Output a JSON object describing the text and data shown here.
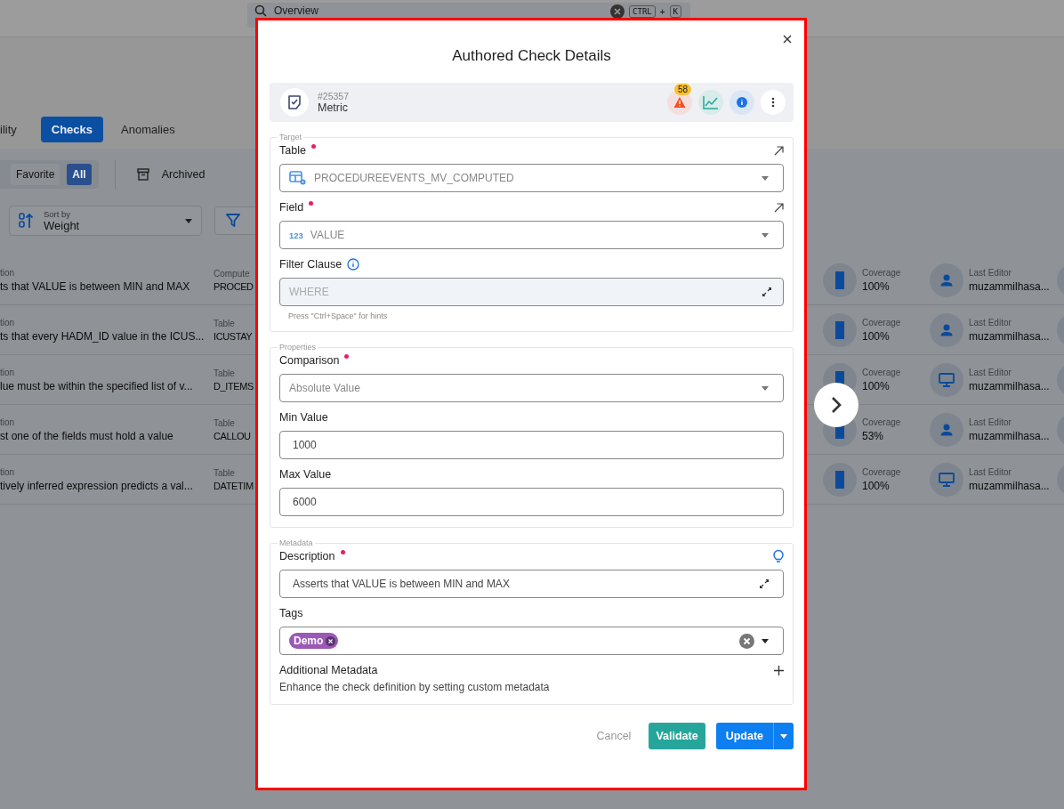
{
  "search": {
    "placeholder": "Overview",
    "keys": [
      "CTRL",
      "+",
      "K"
    ]
  },
  "tabs": [
    {
      "label": "ility",
      "selected": false
    },
    {
      "label": "Checks",
      "selected": true
    },
    {
      "label": "Anomalies",
      "selected": false
    }
  ],
  "filters": [
    {
      "label": "Favorite",
      "selected": false
    },
    {
      "label": "All",
      "selected": true
    }
  ],
  "archived": "Archived",
  "sort": {
    "label": "Sort by",
    "value": "Weight"
  },
  "rows": [
    {
      "kind": "user",
      "col1_label": "tion",
      "description": "ts that VALUE is between MIN and MAX",
      "col2_label": "Compute",
      "col2_value": "PROCED",
      "coverage_label": "Coverage",
      "coverage": "100%",
      "editor_label": "Last Editor",
      "editor": "muzammilhasa..."
    },
    {
      "kind": "user",
      "col1_label": "tion",
      "description": "ts that every HADM_ID value in the ICUS...",
      "col2_label": "Table",
      "col2_value": "ICUSTAY",
      "coverage_label": "Coverage",
      "coverage": "100%",
      "editor_label": "Last Editor",
      "editor": "muzammilhasa..."
    },
    {
      "kind": "system",
      "col1_label": "tion",
      "description": "lue must be within the specified list of v...",
      "col2_label": "Table",
      "col2_value": "D_ITEMS",
      "coverage_label": "Coverage",
      "coverage": "100%",
      "editor_label": "Last Editor",
      "editor": "muzammilhasa..."
    },
    {
      "kind": "user",
      "col1_label": "tion",
      "description": "st one of the fields must hold a value",
      "col2_label": "Table",
      "col2_value": "CALLOU",
      "coverage_label": "Coverage",
      "coverage": "53%",
      "editor_label": "Last Editor",
      "editor": "muzammilhasa..."
    },
    {
      "kind": "system",
      "col1_label": "tion",
      "description": "tively inferred expression predicts a val...",
      "col2_label": "Table",
      "col2_value": "DATETIM",
      "coverage_label": "Coverage",
      "coverage": "100%",
      "editor_label": "Last Editor",
      "editor": "muzammilhasa..."
    }
  ],
  "modal": {
    "title": "Authored Check Details",
    "check": {
      "id": "#25357",
      "type": "Metric",
      "anomaly_count": "58"
    },
    "sections": [
      {
        "legend": "Target",
        "fields": [
          {
            "kind": "table-select",
            "label": "Table",
            "required": true,
            "link": true,
            "value": "PROCEDUREEVENTS_MV_COMPUTED"
          },
          {
            "kind": "field-select",
            "label": "Field",
            "required": true,
            "link": true,
            "badge": "123",
            "value": "VALUE"
          },
          {
            "kind": "code",
            "label": "Filter Clause",
            "required": false,
            "info": true,
            "placeholder": "WHERE",
            "hint": "Press \"Ctrl+Space\" for hints"
          }
        ]
      },
      {
        "legend": "Properties",
        "fields": [
          {
            "kind": "select",
            "label": "Comparison",
            "required": true,
            "value": "Absolute Value"
          },
          {
            "kind": "input",
            "label": "Min Value",
            "required": false,
            "value": "1000"
          },
          {
            "kind": "input",
            "label": "Max Value",
            "required": false,
            "value": "6000"
          }
        ]
      },
      {
        "legend": "Metadata",
        "fields": [
          {
            "kind": "text",
            "label": "Description",
            "required": true,
            "suggest": true,
            "value": "Asserts that VALUE is between MIN and MAX"
          },
          {
            "kind": "tags",
            "label": "Tags",
            "required": false,
            "tags": [
              {
                "label": "Demo",
                "color": "#9b59b6"
              }
            ]
          },
          {
            "kind": "extra",
            "label": "Additional Metadata",
            "required": false,
            "help": "Enhance the check definition by setting custom metadata"
          }
        ]
      }
    ],
    "buttons": {
      "cancel": "Cancel",
      "validate": "Validate",
      "update": "Update"
    }
  }
}
